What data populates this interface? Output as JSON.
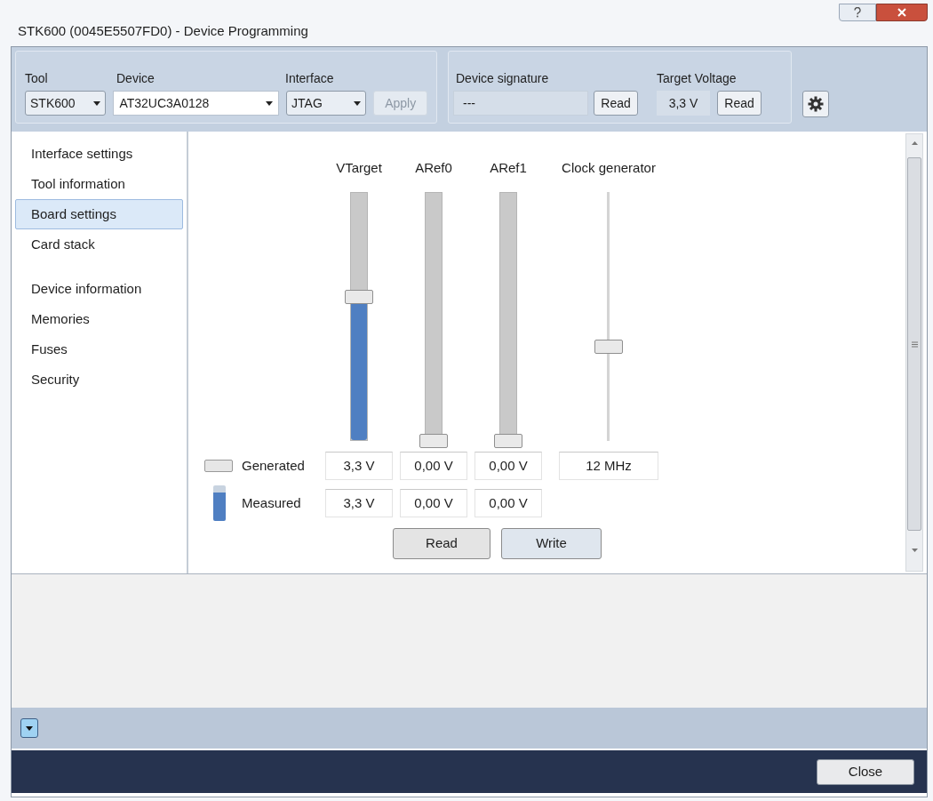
{
  "window": {
    "title": "STK600 (0045E5507FD0) - Device Programming"
  },
  "toolbar": {
    "tool": {
      "label": "Tool",
      "value": "STK600"
    },
    "device": {
      "label": "Device",
      "value": "AT32UC3A0128"
    },
    "interface": {
      "label": "Interface",
      "value": "JTAG"
    },
    "apply": {
      "label": "Apply",
      "disabled": true
    },
    "device_signature": {
      "label": "Device signature",
      "value": "---",
      "button": "Read"
    },
    "target_voltage": {
      "label": "Target Voltage",
      "value": "3,3 V",
      "button": "Read"
    }
  },
  "sidebar": {
    "groups": [
      {
        "items": [
          {
            "label": "Interface settings",
            "selected": false
          },
          {
            "label": "Tool information",
            "selected": false
          },
          {
            "label": "Board settings",
            "selected": true
          },
          {
            "label": "Card stack",
            "selected": false
          }
        ]
      },
      {
        "items": [
          {
            "label": "Device information",
            "selected": false
          },
          {
            "label": "Memories",
            "selected": false
          },
          {
            "label": "Fuses",
            "selected": false
          },
          {
            "label": "Security",
            "selected": false
          }
        ]
      }
    ]
  },
  "board": {
    "legend": [
      {
        "kind": "generated",
        "label": "Generated"
      },
      {
        "kind": "measured",
        "label": "Measured"
      }
    ],
    "channels": [
      {
        "name": "VTarget",
        "kind": "bar",
        "level": 0.58,
        "generated": "3,3 V",
        "measured": "3,3 V"
      },
      {
        "name": "ARef0",
        "kind": "bar",
        "level": 0,
        "generated": "0,00 V",
        "measured": "0,00 V"
      },
      {
        "name": "ARef1",
        "kind": "bar",
        "level": 0,
        "generated": "0,00 V",
        "measured": "0,00 V"
      },
      {
        "name": "Clock generator",
        "kind": "slider",
        "level": 0.38,
        "generated": "12 MHz"
      }
    ],
    "buttons": [
      "Read",
      "Write"
    ]
  },
  "footer": {
    "close": "Close"
  }
}
